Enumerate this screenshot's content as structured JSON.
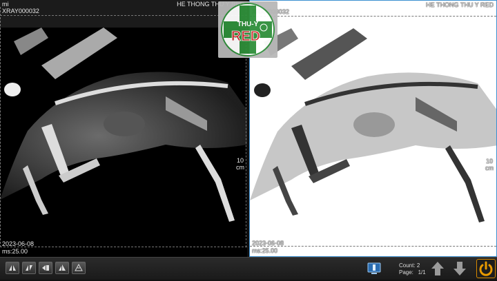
{
  "app": {
    "title": "HE THONG THU Y RED"
  },
  "left_view": {
    "corner_label": "mi",
    "study_id": "XRAY000032",
    "clinic": "HE THONG THU Y RED",
    "scale_value": "10",
    "scale_unit": "cm",
    "date": "2023-06-08",
    "ms": "ms:25.00"
  },
  "right_view": {
    "corner_label": "mi",
    "study_id": "XRAY000032",
    "clinic": "HE THONG THU Y RED",
    "scale_value": "10",
    "scale_unit": "cm",
    "date": "2023-06-08",
    "ms": "ms:25.00",
    "inverted": true
  },
  "logo": {
    "text_top": "THU-Y",
    "text_main": "RED",
    "brand_green": "#2f8f3a",
    "brand_red": "#d0282c"
  },
  "toolbar": {
    "tools": [
      {
        "icon": "flip-horizontal-icon"
      },
      {
        "icon": "flip-horizontal-alt-icon"
      },
      {
        "icon": "rotate-left-icon"
      },
      {
        "icon": "flip-vertical-icon"
      },
      {
        "icon": "rotate-right-icon"
      }
    ],
    "count_label": "Count:",
    "count_value": "2",
    "page_label": "Page:",
    "page_value": "1/1"
  },
  "colors": {
    "accent": "#3a8fd0",
    "power": "#e89a00"
  }
}
